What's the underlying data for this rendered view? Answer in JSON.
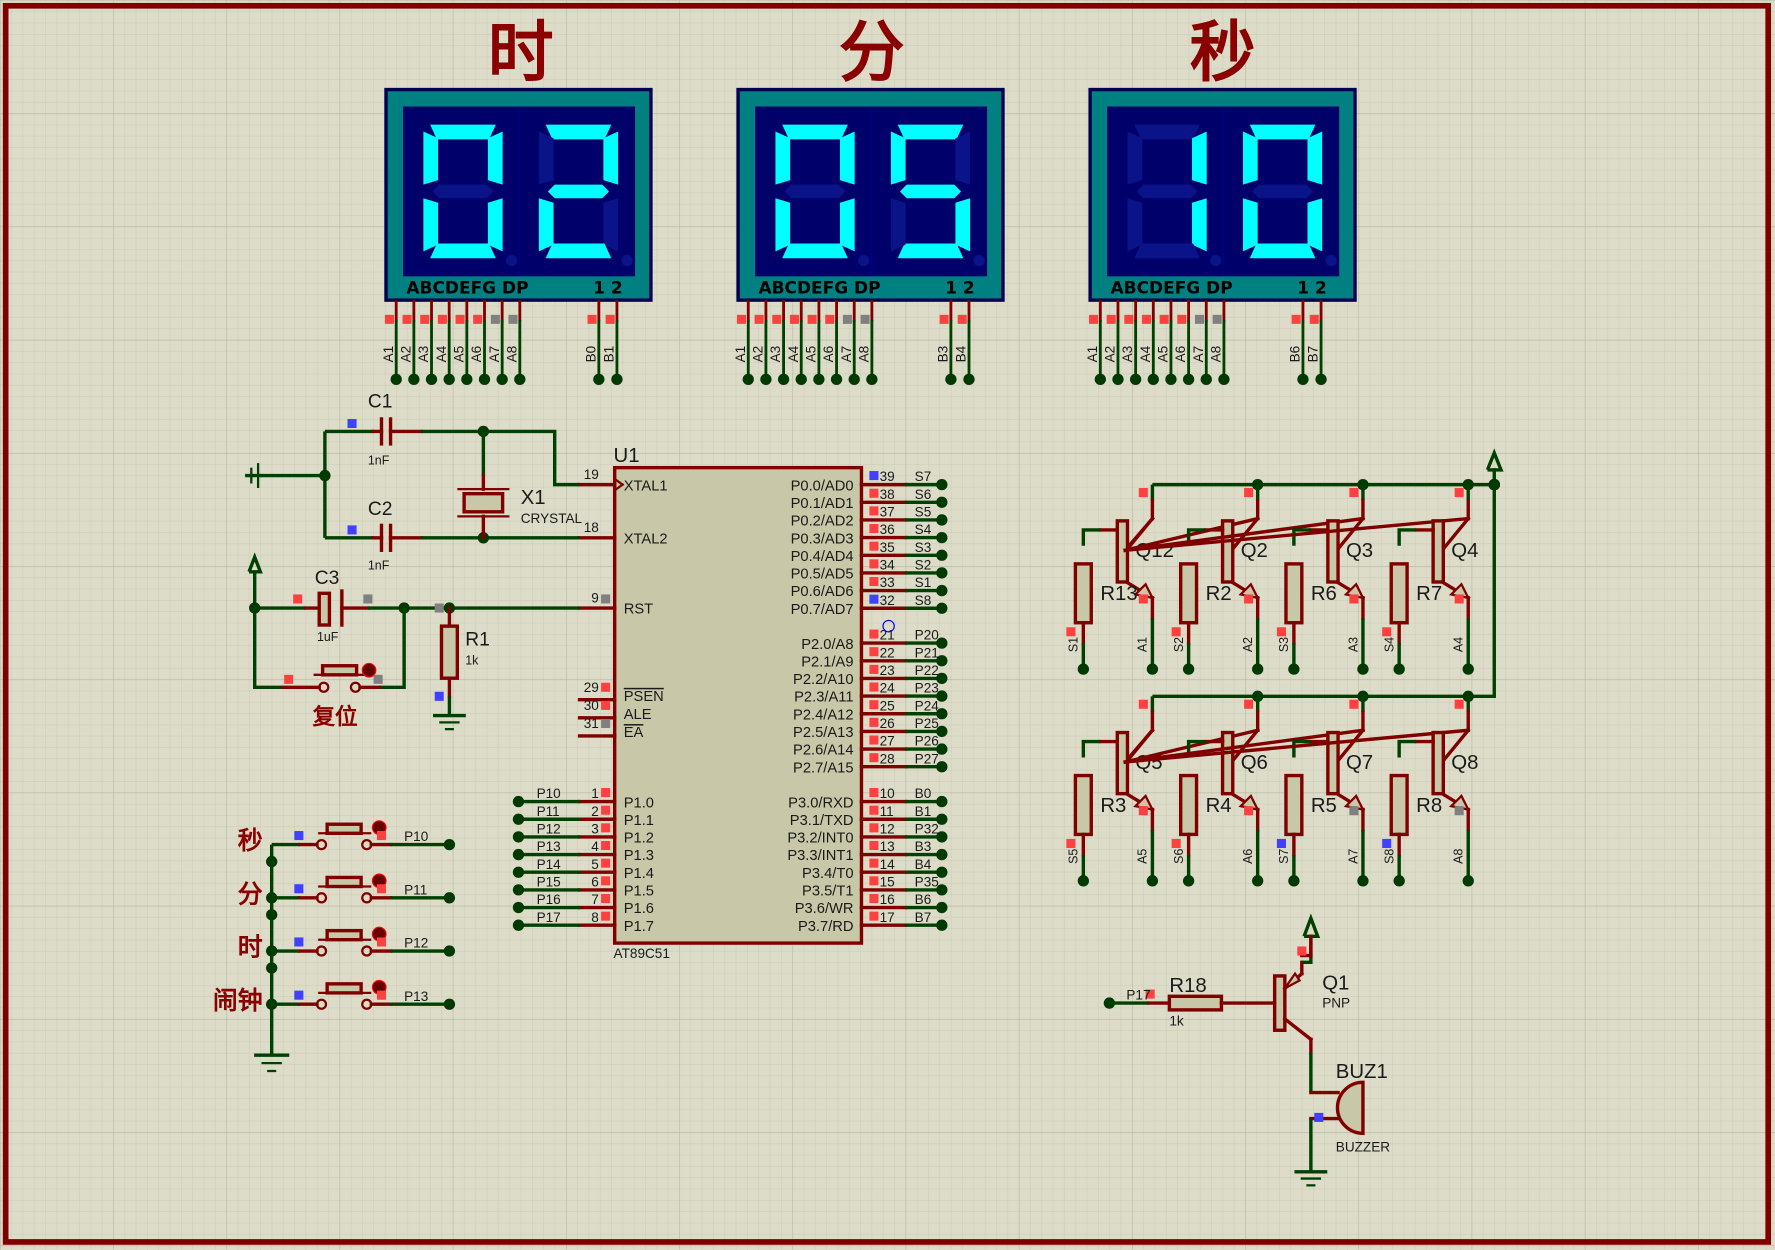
{
  "titles": [
    "时",
    "分",
    "秒"
  ],
  "displays": [
    {
      "digits": "02",
      "header": "ABCDEFG  DP",
      "digit_ids": "1 2",
      "seg_pins": [
        "A1",
        "A2",
        "A3",
        "A4",
        "A5",
        "A6",
        "A7",
        "A8"
      ],
      "digit_pins": [
        "B0",
        "B1"
      ]
    },
    {
      "digits": "05",
      "header": "ABCDEFG  DP",
      "digit_ids": "1 2",
      "seg_pins": [
        "A1",
        "A2",
        "A3",
        "A4",
        "A5",
        "A6",
        "A7",
        "A8"
      ],
      "digit_pins": [
        "B3",
        "B4"
      ]
    },
    {
      "digits": "10",
      "header": "ABCDEFG  DP",
      "digit_ids": "1 2",
      "seg_pins": [
        "A1",
        "A2",
        "A3",
        "A4",
        "A5",
        "A6",
        "A7",
        "A8"
      ],
      "digit_pins": [
        "B6",
        "B7"
      ]
    }
  ],
  "colors": {
    "background": "#dcdcc8",
    "wire": "#004000",
    "component": "#800000",
    "display_body": "#008080",
    "display_panel": "#00006a",
    "segment_on": "#00ffff"
  },
  "u1": {
    "ref": "U1",
    "part": "AT89C51",
    "left_top": [
      {
        "num": "19",
        "name": "XTAL1"
      },
      {
        "num": "18",
        "name": "XTAL2"
      },
      {
        "num": "9",
        "name": "RST"
      }
    ],
    "left_ctrl": [
      {
        "num": "29",
        "name": "PSEN"
      },
      {
        "num": "30",
        "name": "ALE"
      },
      {
        "num": "31",
        "name": "EA"
      }
    ],
    "port1": [
      {
        "num": "1",
        "name": "P1.0",
        "net": "P10"
      },
      {
        "num": "2",
        "name": "P1.1",
        "net": "P11"
      },
      {
        "num": "3",
        "name": "P1.2",
        "net": "P12"
      },
      {
        "num": "4",
        "name": "P1.3",
        "net": "P13"
      },
      {
        "num": "5",
        "name": "P1.4",
        "net": "P14"
      },
      {
        "num": "6",
        "name": "P1.5",
        "net": "P15"
      },
      {
        "num": "7",
        "name": "P1.6",
        "net": "P16"
      },
      {
        "num": "8",
        "name": "P1.7",
        "net": "P17"
      }
    ],
    "port0": [
      {
        "num": "39",
        "name": "P0.0/AD0",
        "net": "S7"
      },
      {
        "num": "38",
        "name": "P0.1/AD1",
        "net": "S6"
      },
      {
        "num": "37",
        "name": "P0.2/AD2",
        "net": "S5"
      },
      {
        "num": "36",
        "name": "P0.3/AD3",
        "net": "S4"
      },
      {
        "num": "35",
        "name": "P0.4/AD4",
        "net": "S3"
      },
      {
        "num": "34",
        "name": "P0.5/AD5",
        "net": "S2"
      },
      {
        "num": "33",
        "name": "P0.6/AD6",
        "net": "S1"
      },
      {
        "num": "32",
        "name": "P0.7/AD7",
        "net": "S8"
      }
    ],
    "port2": [
      {
        "num": "21",
        "name": "P2.0/A8",
        "net": "P20"
      },
      {
        "num": "22",
        "name": "P2.1/A9",
        "net": "P21"
      },
      {
        "num": "23",
        "name": "P2.2/A10",
        "net": "P22"
      },
      {
        "num": "24",
        "name": "P2.3/A11",
        "net": "P23"
      },
      {
        "num": "25",
        "name": "P2.4/A12",
        "net": "P24"
      },
      {
        "num": "26",
        "name": "P2.5/A13",
        "net": "P25"
      },
      {
        "num": "27",
        "name": "P2.6/A14",
        "net": "P26"
      },
      {
        "num": "28",
        "name": "P2.7/A15",
        "net": "P27"
      }
    ],
    "port3": [
      {
        "num": "10",
        "name": "P3.0/RXD",
        "net": "B0"
      },
      {
        "num": "11",
        "name": "P3.1/TXD",
        "net": "B1"
      },
      {
        "num": "12",
        "name": "P3.2/INT0",
        "net": "P32"
      },
      {
        "num": "13",
        "name": "P3.3/INT1",
        "net": "B3"
      },
      {
        "num": "14",
        "name": "P3.4/T0",
        "net": "B4"
      },
      {
        "num": "15",
        "name": "P3.5/T1",
        "net": "P35"
      },
      {
        "num": "16",
        "name": "P3.6/WR",
        "net": "B6"
      },
      {
        "num": "17",
        "name": "P3.7/RD",
        "net": "B7"
      }
    ]
  },
  "clock": {
    "c1": "C1",
    "c1_value": "1nF",
    "c2": "C2",
    "c2_value": "1nF",
    "x1": "X1",
    "x1_value": "CRYSTAL"
  },
  "reset": {
    "c3": "C3",
    "c3_value": "1uF",
    "r1": "R1",
    "r1_value": "1k",
    "button_label": "复位"
  },
  "buttons": [
    {
      "label": "秒",
      "net": "P10"
    },
    {
      "label": "分",
      "net": "P11"
    },
    {
      "label": "时",
      "net": "P12"
    },
    {
      "label": "闹钟",
      "net": "P13"
    }
  ],
  "drivers": [
    [
      {
        "q": "Q12",
        "r": "R13",
        "s": "S1",
        "a": "A1"
      },
      {
        "q": "Q2",
        "r": "R2",
        "s": "S2",
        "a": "A2"
      },
      {
        "q": "Q3",
        "r": "R6",
        "s": "S3",
        "a": "A3"
      },
      {
        "q": "Q4",
        "r": "R7",
        "s": "S4",
        "a": "A4"
      }
    ],
    [
      {
        "q": "Q5",
        "r": "R3",
        "s": "S5",
        "a": "A5"
      },
      {
        "q": "Q6",
        "r": "R4",
        "s": "S6",
        "a": "A6"
      },
      {
        "q": "Q7",
        "r": "R5",
        "s": "S7",
        "a": "A7"
      },
      {
        "q": "Q8",
        "r": "R8",
        "s": "S8",
        "a": "A8"
      }
    ]
  ],
  "buzzer": {
    "net": "P17",
    "r": "R18",
    "r_value": "1k",
    "q": "Q1",
    "q_type": "PNP",
    "buz": "BUZ1",
    "buz_type": "BUZZER"
  }
}
